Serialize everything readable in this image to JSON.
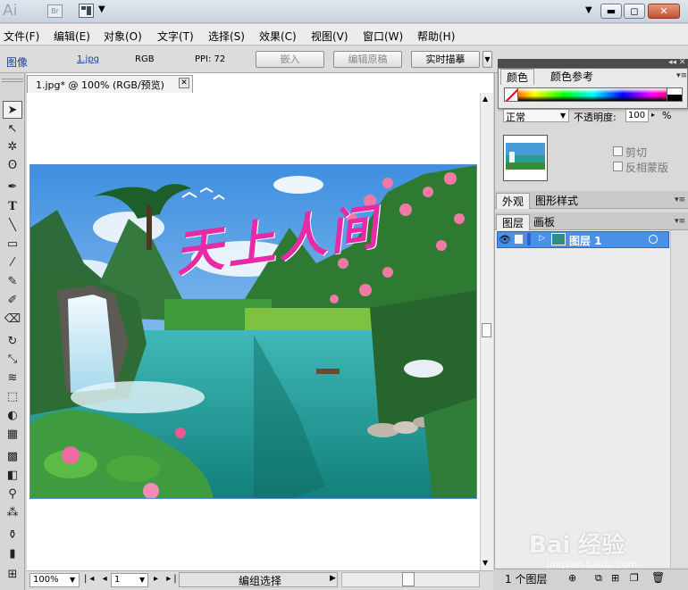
{
  "app": {
    "logo_text": "Ai",
    "bridge_label": "Br"
  },
  "menu": [
    "文件(F)",
    "编辑(E)",
    "对象(O)",
    "文字(T)",
    "选择(S)",
    "效果(C)",
    "视图(V)",
    "窗口(W)",
    "帮助(H)"
  ],
  "control": {
    "object_type": "图像",
    "file_link": "1.jpg",
    "color_mode": "RGB",
    "ppi": "PPI: 72",
    "embed_button": "嵌入",
    "edit_original_button": "编辑原稿",
    "live_trace_button": "实时描摹"
  },
  "document": {
    "tab_title": "1.jpg* @ 100% (RGB/预览)"
  },
  "artwork": {
    "calligraphy_text": "天上人间"
  },
  "status": {
    "zoom": "100%",
    "artboard": "1",
    "tool_status": "编组选择"
  },
  "color_panel": {
    "tab_color": "颜色",
    "tab_color_guide": "颜色参考"
  },
  "transparency": {
    "blend_mode": "正常",
    "opacity_label": "不透明度:",
    "opacity_value": "100",
    "opacity_unit": "%",
    "clip_label": "剪切",
    "invert_mask_label": "反相蒙版"
  },
  "appearance": {
    "tab_appearance": "外观",
    "tab_graphic_styles": "图形样式"
  },
  "layers": {
    "tab_layers": "图层",
    "tab_artboards": "画板",
    "layer_name": "图层 1",
    "footer_count": "1 个图层"
  },
  "watermark": {
    "brand": "Bai 经验",
    "url": "jingyan.baidu.com"
  },
  "colors": {
    "selection": "#4a8fe8",
    "calligraphy": "#e62aa8"
  }
}
